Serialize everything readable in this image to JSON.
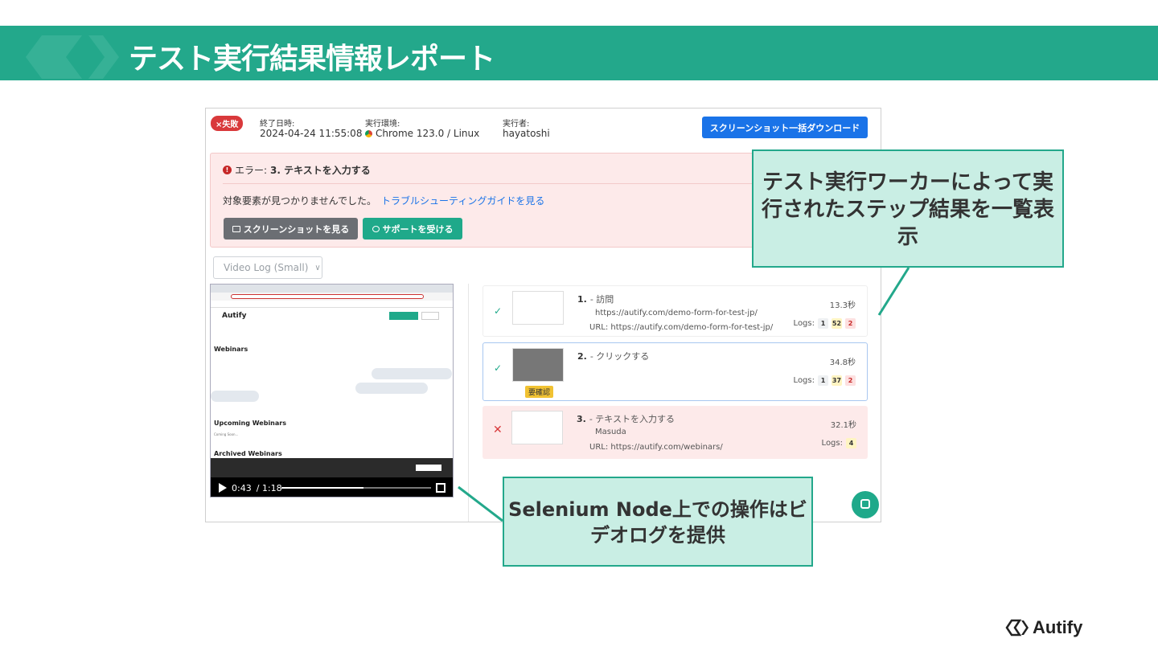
{
  "banner": {
    "title": "テスト実行結果情報レポート"
  },
  "result": {
    "status_badge": "×失敗",
    "end_label": "終了日時:",
    "end_value": "2024-04-24 11:55:08",
    "env_label": "実行環境:",
    "env_value": "Chrome 123.0 / Linux",
    "runner_label": "実行者:",
    "runner_value": "hayatoshi",
    "download_button": "スクリーンショット一括ダウンロード"
  },
  "error": {
    "prefix": "エラー:",
    "step": "3. テキストを入力する",
    "message": "対象要素が見つかりませんでした。",
    "link": "トラブルシューティングガイドを見る",
    "screenshots_button": "スクリーンショットを見る",
    "support_button": "サポートを受ける"
  },
  "video": {
    "select_value": "Video Log (Small)",
    "site_name": "Autify",
    "heading_webinars": "Webinars",
    "heading_upcoming": "Upcoming Webinars",
    "heading_archived": "Archived Webinars",
    "coming_soon": "Coming Soon...",
    "current_time": "0:43",
    "total_time": "/ 1:18",
    "progress": 0.55
  },
  "steps": [
    {
      "num": "1.",
      "name": "- 訪問",
      "line1": "https://autify.com/demo-form-for-test-jp/",
      "url": "URL: https://autify.com/demo-form-for-test-jp/",
      "time": "13.3秒",
      "logs_label": "Logs:",
      "logs": [
        "1",
        "52",
        "2"
      ],
      "status": "success"
    },
    {
      "num": "2.",
      "name": "- クリックする",
      "line1": "",
      "url": "",
      "time": "34.8秒",
      "logs_label": "Logs:",
      "logs": [
        "1",
        "37",
        "2"
      ],
      "status": "success",
      "badge": "要確認"
    },
    {
      "num": "3.",
      "name": "- テキストを入力する",
      "line1": "Masuda",
      "url": "URL: https://autify.com/webinars/",
      "time": "32.1秒",
      "logs_label": "Logs:",
      "logs": [
        "4"
      ],
      "status": "failed"
    }
  ],
  "callouts": {
    "steps": "テスト実行ワーカーによって実行されたステップ結果を一覧表示",
    "video": "Selenium Node上での操作はビデオログを提供"
  },
  "footer": {
    "brand": "Autify"
  },
  "colors": {
    "brand": "#23a88b",
    "fail": "#d9393b",
    "link": "#1a73e8"
  }
}
